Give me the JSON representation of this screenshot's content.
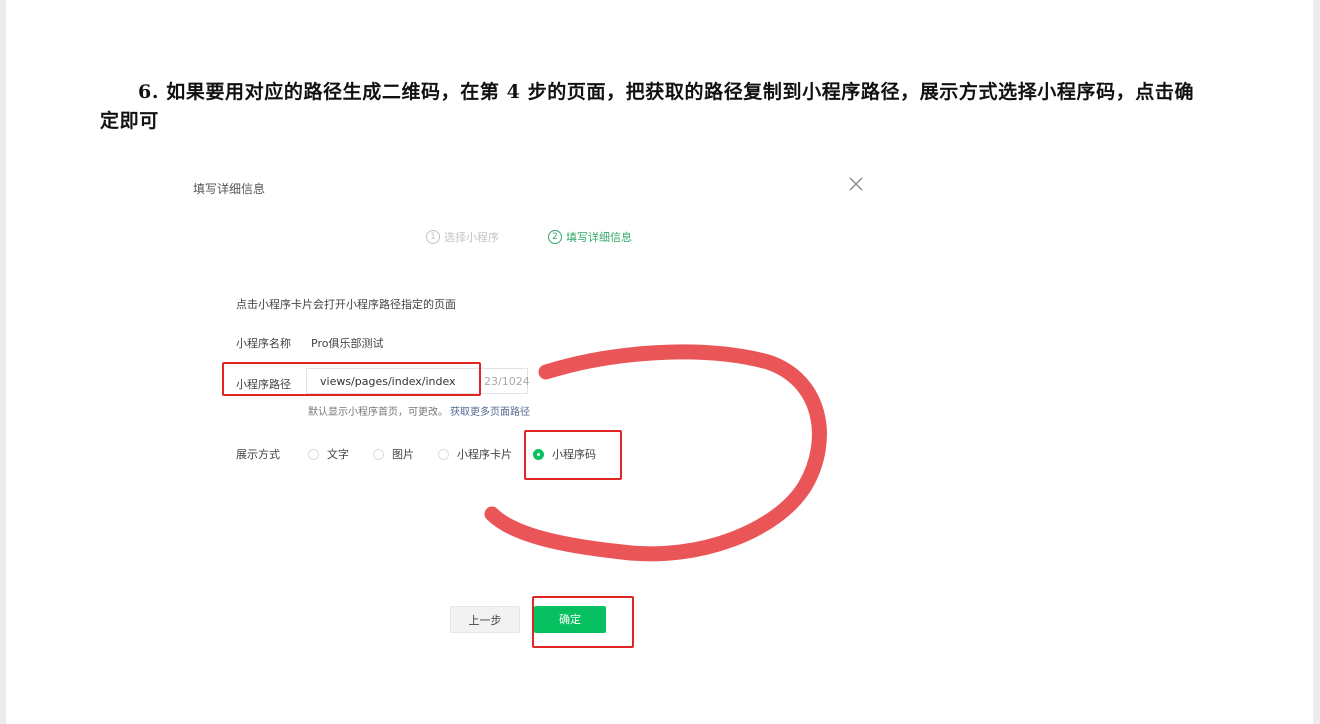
{
  "instruction": {
    "text": "6. 如果要用对应的路径生成二维码，在第 4 步的页面，把获取的路径复制到小程序路径，展示方式选择小程序码，点击确定即可"
  },
  "dialog": {
    "title": "填写详细信息",
    "steps": [
      {
        "num": "1",
        "label": "选择小程序",
        "state": "done"
      },
      {
        "num": "2",
        "label": "填写详细信息",
        "state": "active"
      }
    ],
    "hint": "点击小程序卡片会打开小程序路径指定的页面",
    "name_label": "小程序名称",
    "name_value": "Pro俱乐部测试",
    "path_label": "小程序路径",
    "path_value": "views/pages/index/index",
    "path_counter": "23/1024",
    "path_help": "默认显示小程序首页，可更改。",
    "path_help_link": "获取更多页面路径",
    "display_label": "展示方式",
    "display_options": [
      {
        "label": "文字",
        "selected": false
      },
      {
        "label": "图片",
        "selected": false
      },
      {
        "label": "小程序卡片",
        "selected": false
      },
      {
        "label": "小程序码",
        "selected": true
      }
    ],
    "prev_button": "上一步",
    "confirm_button": "确定"
  },
  "colors": {
    "accent_green": "#07c160",
    "annotation_red": "#e02525",
    "link_blue": "#576b95"
  },
  "icons": [
    "close-icon"
  ]
}
